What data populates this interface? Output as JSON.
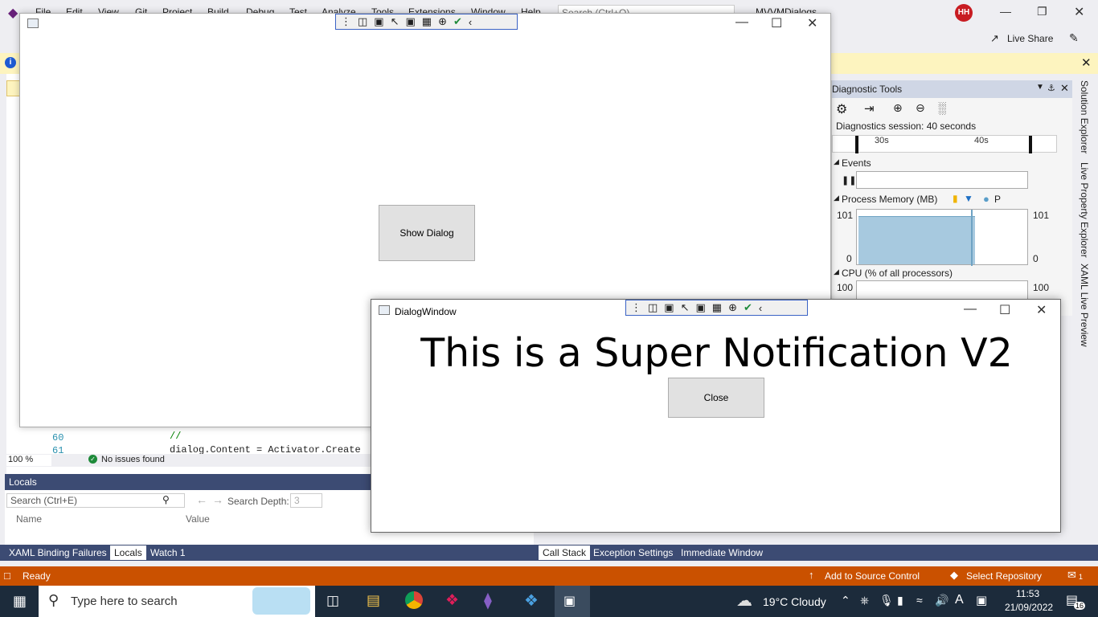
{
  "vs": {
    "menu": [
      "File",
      "Edit",
      "View",
      "Git",
      "Project",
      "Build",
      "Debug",
      "Test",
      "Analyze",
      "Tools",
      "Extensions",
      "Window",
      "Help"
    ],
    "search_placeholder": "Search (Ctrl+Q)",
    "solution_name": "MVVMDialogs",
    "avatar_initials": "HH",
    "live_share": "Live Share"
  },
  "diagnostics": {
    "title": "Diagnostic Tools",
    "session": "Diagnostics session: 40 seconds",
    "tick_30": "30s",
    "tick_40": "40s",
    "events_label": "Events",
    "memory_label": "Process Memory (MB)",
    "memory_legend": "P",
    "memory_max": "101",
    "memory_min": "0",
    "cpu_label": "CPU (% of all processors)",
    "cpu_max": "100"
  },
  "side_tabs": [
    "Solution Explorer",
    "Live Property Explorer",
    "XAML Live Preview"
  ],
  "code": {
    "lines": [
      {
        "num": "60",
        "text": "//"
      },
      {
        "num": "61",
        "text": "dialog.Content = Activator.Create"
      }
    ],
    "zoom": "100 %",
    "issues": "No issues found"
  },
  "locals": {
    "title": "Locals",
    "search_placeholder": "Search (Ctrl+E)",
    "search_depth_label": "Search Depth:",
    "search_depth_value": "3",
    "col_name": "Name",
    "col_value": "Value"
  },
  "bottom_tabs_left": [
    "XAML Binding Failures",
    "Locals",
    "Watch 1"
  ],
  "bottom_tabs_right": [
    "Call Stack",
    "Exception Settings",
    "Immediate Window"
  ],
  "status": {
    "ready": "Ready",
    "source_control": "Add to Source Control",
    "repository": "Select Repository",
    "notif_count": "1"
  },
  "taskbar": {
    "search_placeholder": "Type here to search",
    "weather": "19°C  Cloudy",
    "time": "11:53",
    "date": "21/09/2022",
    "notif_badge": "16"
  },
  "main_window": {
    "show_dialog_label": "Show Dialog"
  },
  "dialog": {
    "title": "DialogWindow",
    "message": "This is a Super Notification V2",
    "close_label": "Close"
  },
  "colors": {
    "accent": "#3c4b73",
    "status_bar": "#ca5100",
    "taskbar": "#1c2b3b",
    "memory_fill": "#a7c9df"
  },
  "chart_data": {
    "type": "area",
    "title": "Process Memory (MB)",
    "ylim": [
      0,
      101
    ]
  }
}
